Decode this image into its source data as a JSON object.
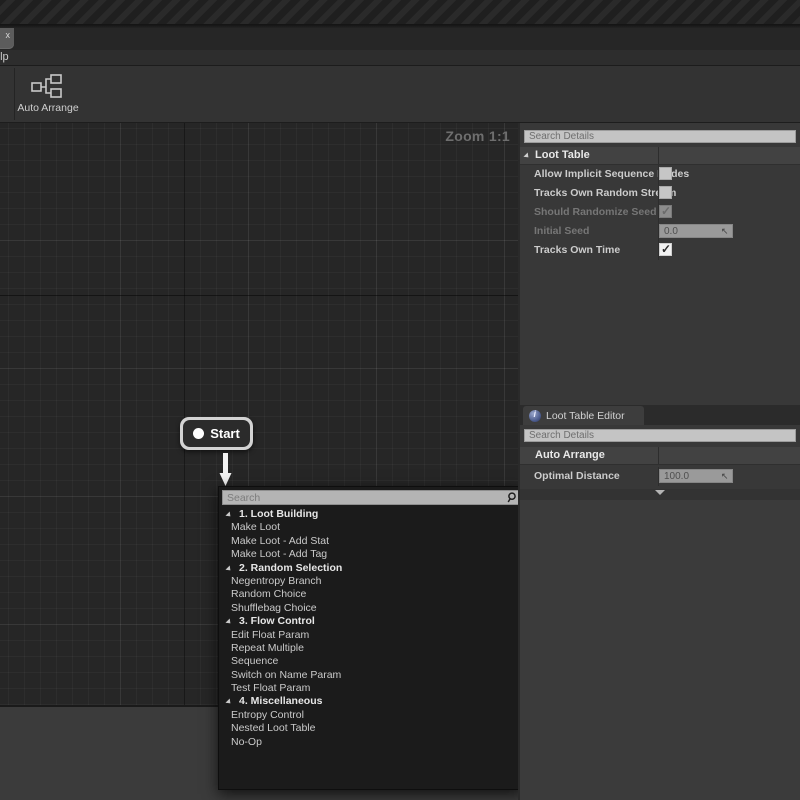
{
  "window": {
    "tab_close_label": "x",
    "menu_visible_text": "elp"
  },
  "toolbar": {
    "auto_arrange_label": "Auto Arrange",
    "auto_arrange_icon": "auto-arrange-icon"
  },
  "graph": {
    "zoom_label": "Zoom 1:1",
    "nodes": [
      {
        "label": "Start",
        "icon": "exec-pin-dot"
      }
    ]
  },
  "context_menu": {
    "search_placeholder": "Search",
    "search_value": "",
    "search_icon": "search-icon",
    "categories": [
      {
        "label": "1. Loot Building",
        "items": [
          "Make Loot",
          "Make Loot - Add Stat",
          "Make Loot - Add Tag"
        ]
      },
      {
        "label": "2. Random Selection",
        "items": [
          "Negentropy Branch",
          "Random Choice",
          "Shufflebag Choice"
        ]
      },
      {
        "label": "3. Flow Control",
        "items": [
          "Edit Float Param",
          "Repeat Multiple",
          "Sequence",
          "Switch on Name Param",
          "Test Float Param"
        ]
      },
      {
        "label": "4. Miscellaneous",
        "items": [
          "Entropy Control",
          "Nested Loot Table",
          "No-Op"
        ]
      }
    ]
  },
  "details_panel": {
    "search_placeholder": "Search Details",
    "search_value": "",
    "category": "Loot Table",
    "rows": [
      {
        "label": "Allow Implicit Sequence Nodes",
        "type": "checkbox",
        "checked": false,
        "enabled": true
      },
      {
        "label": "Tracks Own Random Stream",
        "type": "checkbox",
        "checked": false,
        "enabled": true
      },
      {
        "label": "Should Randomize Seed",
        "type": "checkbox",
        "checked": true,
        "enabled": false
      },
      {
        "label": "Initial Seed",
        "type": "number",
        "value": "0.0",
        "enabled": false
      },
      {
        "label": "Tracks Own Time",
        "type": "checkbox",
        "checked": true,
        "enabled": true
      }
    ]
  },
  "editor_settings_panel": {
    "tab_label": "Loot Table Editor S",
    "tab_icon": "info-icon",
    "search_placeholder": "Search Details",
    "search_value": "",
    "category": "Auto Arrange",
    "rows": [
      {
        "label": "Optimal Distance",
        "type": "number",
        "value": "100.0",
        "enabled": true
      }
    ],
    "expand_icon": "chevron-down-icon"
  },
  "colors": {
    "panel_bg": "#383838",
    "graph_bg": "#262626",
    "menu_bg": "#1b1b1b",
    "accent_text": "#e8e8e8"
  }
}
